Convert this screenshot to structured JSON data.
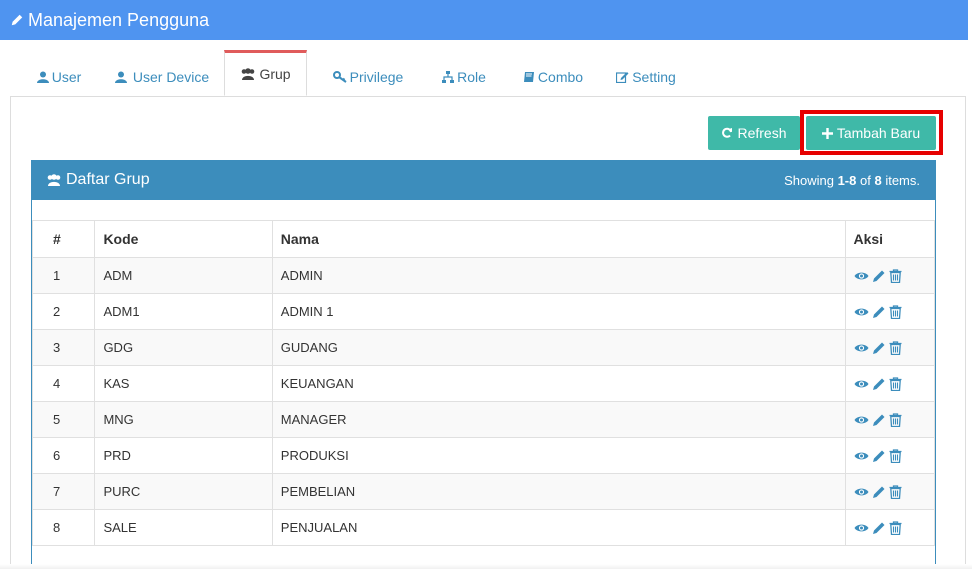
{
  "header": {
    "title": "Manajemen Pengguna"
  },
  "tabs": [
    {
      "label": "User",
      "icon": "user-icon"
    },
    {
      "label": "User Device",
      "icon": "user-icon"
    },
    {
      "label": "Grup",
      "icon": "users-icon"
    },
    {
      "label": "Privilege",
      "icon": "key-icon"
    },
    {
      "label": "Role",
      "icon": "sitemap-icon"
    },
    {
      "label": "Combo",
      "icon": "book-icon"
    },
    {
      "label": "Setting",
      "icon": "edit-icon"
    }
  ],
  "active_tab": "Grup",
  "toolbar": {
    "refresh_label": "Refresh",
    "add_label": "Tambah Baru"
  },
  "panel": {
    "title": "Daftar Grup",
    "summary_prefix": "Showing ",
    "summary_range": "1-8",
    "summary_of": " of ",
    "summary_total": "8",
    "summary_suffix": " items."
  },
  "table": {
    "headers": {
      "num": "#",
      "kode": "Kode",
      "nama": "Nama",
      "aksi": "Aksi"
    },
    "rows": [
      {
        "num": "1",
        "kode": "ADM",
        "nama": "ADMIN"
      },
      {
        "num": "2",
        "kode": "ADM1",
        "nama": "ADMIN 1"
      },
      {
        "num": "3",
        "kode": "GDG",
        "nama": "GUDANG"
      },
      {
        "num": "4",
        "kode": "KAS",
        "nama": "KEUANGAN"
      },
      {
        "num": "5",
        "kode": "MNG",
        "nama": "MANAGER"
      },
      {
        "num": "6",
        "kode": "PRD",
        "nama": "PRODUKSI"
      },
      {
        "num": "7",
        "kode": "PURC",
        "nama": "PEMBELIAN"
      },
      {
        "num": "8",
        "kode": "SALE",
        "nama": "PENJUALAN"
      }
    ]
  },
  "colors": {
    "header_bg": "#4f94f0",
    "panel_header_bg": "#3c8dbc",
    "button_bg": "#3fb9a8",
    "active_tab_border": "#e05b5b",
    "highlight": "#e60000"
  }
}
